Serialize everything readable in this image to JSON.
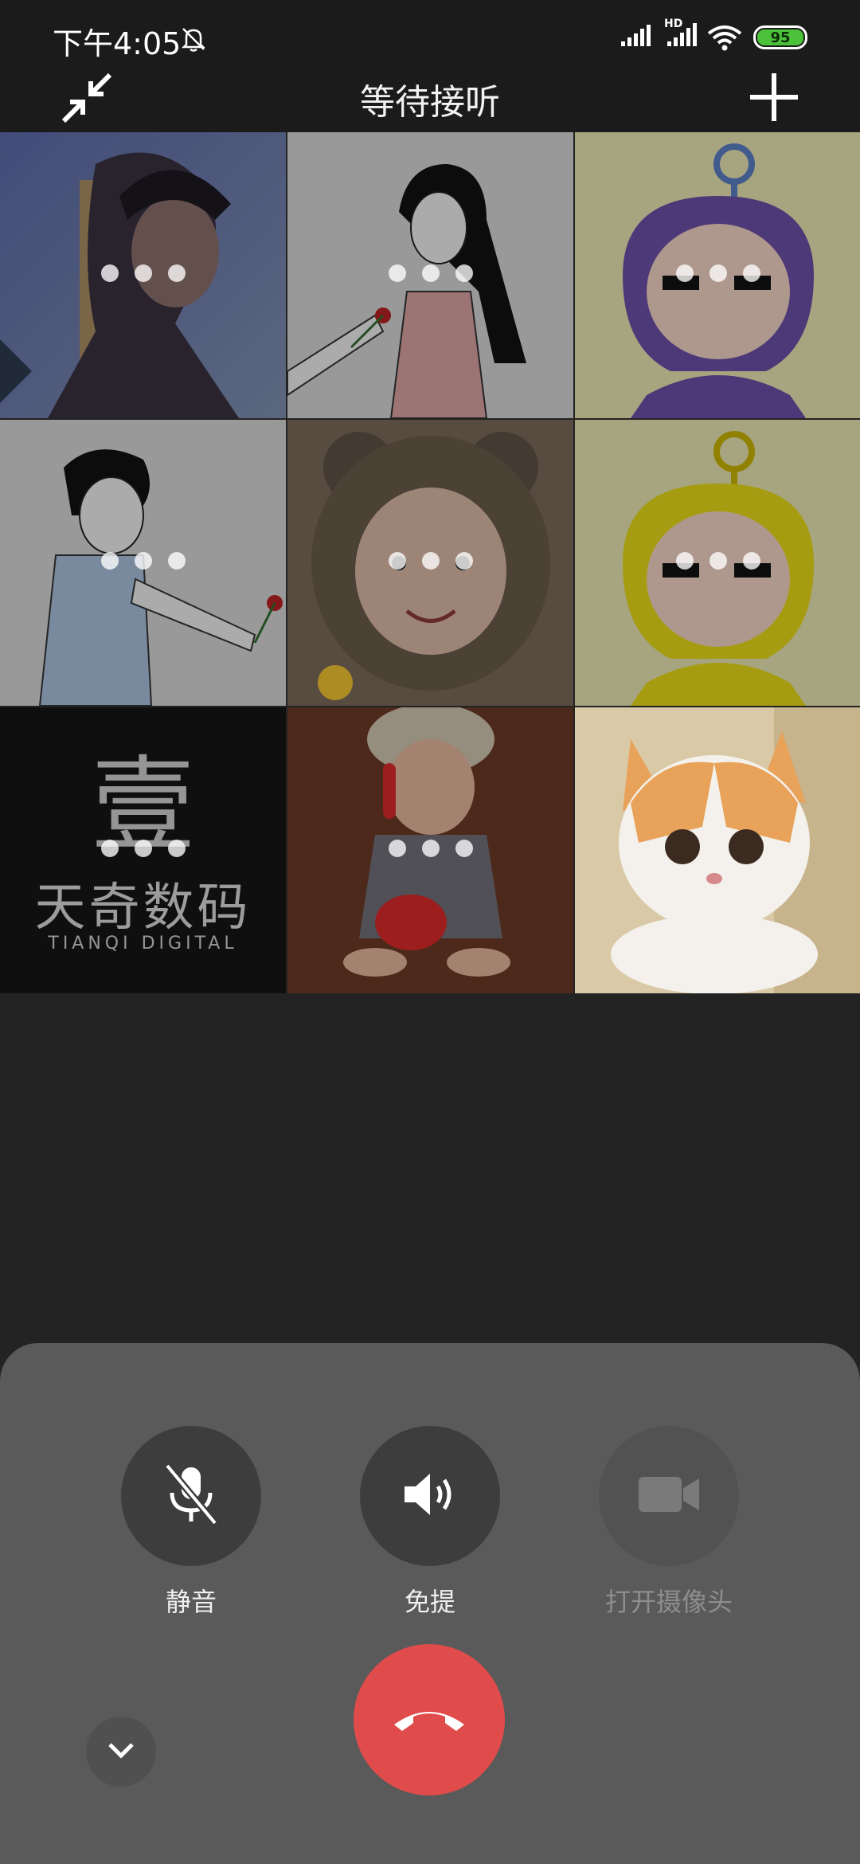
{
  "status_bar": {
    "time": "下午4:05",
    "network_label": "HD",
    "battery_level": "95",
    "battery_color": "#4cc23a"
  },
  "header": {
    "title": "等待接听",
    "minimize_icon": "minimize-arrows-icon",
    "add_icon": "plus-icon"
  },
  "participants": [
    {
      "avatar": "boy-photo",
      "state": "connecting"
    },
    {
      "avatar": "girl-with-rose-drawing",
      "state": "connecting"
    },
    {
      "avatar": "purple-teletubby-drawing",
      "state": "connecting"
    },
    {
      "avatar": "boy-with-rose-drawing",
      "state": "connecting"
    },
    {
      "avatar": "baby-in-bear-hood",
      "state": "connecting"
    },
    {
      "avatar": "yellow-teletubby-drawing",
      "state": "connecting"
    },
    {
      "avatar": "tianqi-digital-logo",
      "state": "connecting",
      "logo_text": "天奇数码",
      "logo_subtext": "TIANQI DIGITAL",
      "logo_glyph": "壹"
    },
    {
      "avatar": "baby-with-phone",
      "state": "connecting"
    },
    {
      "avatar": "exotic-cat",
      "state": "joined"
    }
  ],
  "controls": {
    "mute_label": "静音",
    "speaker_label": "免提",
    "camera_label": "打开摄像头"
  },
  "colors": {
    "hangup": "#e04b4b",
    "panel": "#5a5a5a",
    "background": "#232323"
  }
}
